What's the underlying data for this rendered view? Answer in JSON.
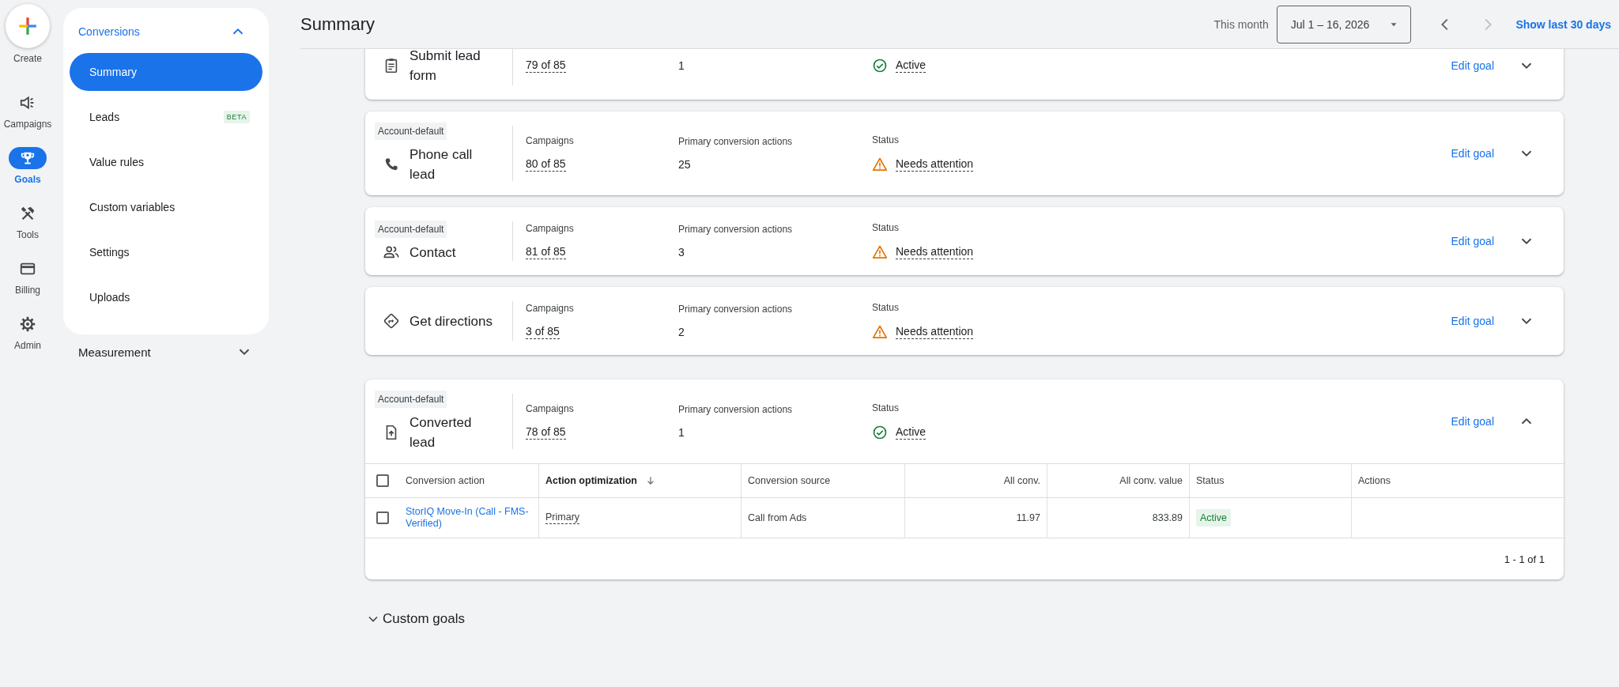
{
  "rail": [
    {
      "label": "Create",
      "kind": "create",
      "selected": false
    },
    {
      "label": "Campaigns",
      "kind": "campaigns",
      "selected": false
    },
    {
      "label": "Goals",
      "kind": "goals",
      "selected": true
    },
    {
      "label": "Tools",
      "kind": "tools",
      "selected": false
    },
    {
      "label": "Billing",
      "kind": "billing",
      "selected": false
    },
    {
      "label": "Admin",
      "kind": "admin",
      "selected": false
    }
  ],
  "nav": {
    "section": {
      "label": "Conversions",
      "expanded": true
    },
    "items": [
      {
        "label": "Summary",
        "selected": true
      },
      {
        "label": "Leads",
        "badge": "BETA",
        "selected": false
      },
      {
        "label": "Value rules",
        "selected": false
      },
      {
        "label": "Custom variables",
        "selected": false
      },
      {
        "label": "Settings",
        "selected": false
      },
      {
        "label": "Uploads",
        "selected": false
      }
    ],
    "sections": [
      {
        "label": "Measurement",
        "expanded": false
      }
    ]
  },
  "header": {
    "title": "Summary",
    "range_label": "This month",
    "date_range": "Jul 1 – 16, 2026",
    "prev_disabled": false,
    "next_disabled": true,
    "link": "Show last 30 days"
  },
  "goals": [
    {
      "kind": "form",
      "name": "Submit lead form",
      "campaigns": "79 of 85",
      "primary": "1",
      "status": {
        "kind": "active",
        "text": "Active"
      },
      "edit": "Edit goal",
      "expanded": false
    },
    {
      "tag": "Account-default",
      "kind": "phone",
      "name": "Phone call lead",
      "campaigns_label": "Campaigns",
      "campaigns": "80 of 85",
      "primary_label": "Primary conversion actions",
      "primary": "25",
      "status_label": "Status",
      "status": {
        "kind": "attention",
        "text": "Needs attention"
      },
      "edit": "Edit goal",
      "expanded": false
    },
    {
      "tag": "Account-default",
      "kind": "contact",
      "name": "Contact",
      "campaigns_label": "Campaigns",
      "campaigns": "81 of 85",
      "primary_label": "Primary conversion actions",
      "primary": "3",
      "status_label": "Status",
      "status": {
        "kind": "attention",
        "text": "Needs attention"
      },
      "edit": "Edit goal",
      "expanded": false
    },
    {
      "kind": "directions",
      "name": "Get directions",
      "campaigns_label": "Campaigns",
      "campaigns": "3 of 85",
      "primary_label": "Primary conversion actions",
      "primary": "2",
      "status_label": "Status",
      "status": {
        "kind": "attention",
        "text": "Needs attention"
      },
      "edit": "Edit goal",
      "expanded": false
    },
    {
      "tag": "Account-default",
      "kind": "import",
      "name": "Converted lead",
      "campaigns_label": "Campaigns",
      "campaigns": "78 of 85",
      "primary_label": "Primary conversion actions",
      "primary": "1",
      "status_label": "Status",
      "status": {
        "kind": "active",
        "text": "Active"
      },
      "edit": "Edit goal",
      "expanded": true,
      "table": {
        "all_selected": false,
        "columns": [
          {
            "label": "Conversion action",
            "kind": "text",
            "sorted": false
          },
          {
            "label": "Action optimization",
            "kind": "text",
            "sorted": true
          },
          {
            "label": "Conversion source",
            "kind": "text",
            "sorted": false
          },
          {
            "label": "All conv.",
            "kind": "number",
            "sorted": false
          },
          {
            "label": "All conv. value",
            "kind": "number",
            "sorted": false
          },
          {
            "label": "Status",
            "kind": "text",
            "sorted": false
          },
          {
            "label": "Actions",
            "kind": "text",
            "sorted": false
          }
        ],
        "rows": [
          {
            "selected": false,
            "cells": [
              {
                "kind": "link",
                "text": "StorIQ Move-In (Call - FMS-Verified)"
              },
              {
                "kind": "dotted",
                "text": "Primary"
              },
              {
                "kind": "text",
                "text": "Call from Ads"
              },
              {
                "kind": "number",
                "text": "11.97"
              },
              {
                "kind": "number",
                "text": "833.89"
              },
              {
                "kind": "chip",
                "text": "Active"
              },
              {
                "kind": "empty"
              }
            ]
          }
        ],
        "pagination": "1 - 1 of 1"
      }
    }
  ],
  "custom_goals": {
    "label": "Custom goals",
    "expanded": false
  }
}
